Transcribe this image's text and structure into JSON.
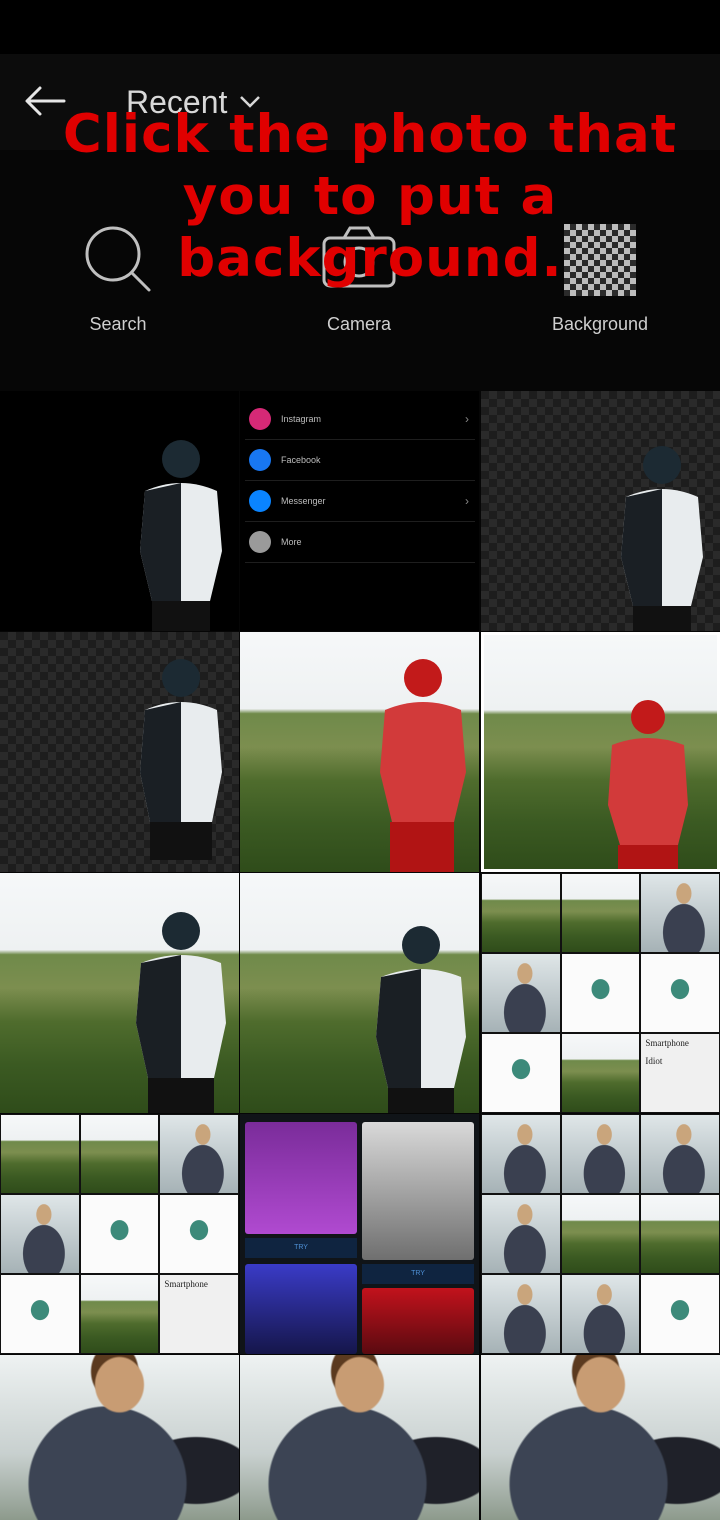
{
  "header": {
    "album_label": "Recent"
  },
  "overlay_instruction": {
    "line1": "Click the photo that",
    "line2": "you to put a",
    "line3": "background."
  },
  "tools": {
    "search": "Search",
    "camera": "Camera",
    "background": "Background"
  },
  "share_sheet": {
    "items": [
      "Instagram",
      "Facebook",
      "Messenger",
      "More"
    ]
  },
  "thumbnail_text": {
    "card_title": "Smartphone",
    "card_line": "Idiot",
    "try_label": "TRY"
  },
  "colors": {
    "overlay_red": "#e00000",
    "instagram": "#d62976",
    "facebook": "#1877f2",
    "messenger": "#0a84ff"
  }
}
